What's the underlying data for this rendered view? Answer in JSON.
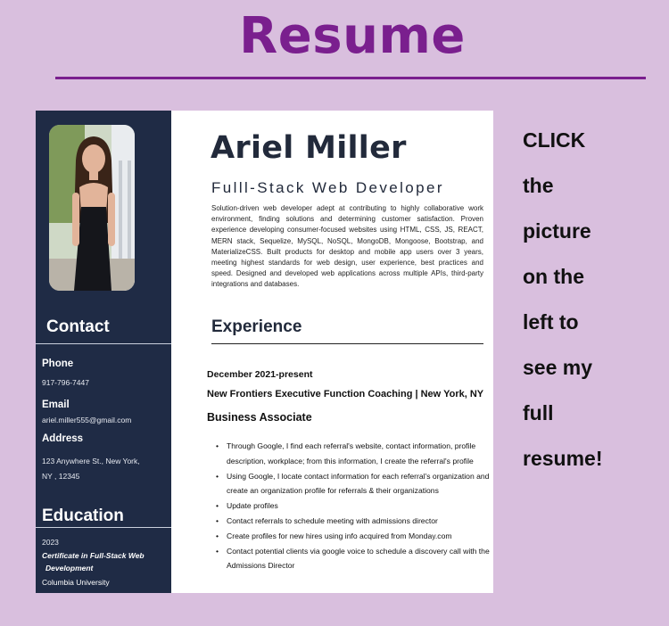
{
  "header": {
    "title": "Resume"
  },
  "resume": {
    "name": "Ariel Miller",
    "role": "Fulll-Stack Web Developer",
    "summary": "Solution-driven web developer adept at contributing to highly collaborative work environment, finding solutions and determining customer satisfaction. Proven experience developing consumer-focused websites using HTML, CSS, JS, REACT, MERN stack, Sequelize, MySQL, NoSQL, MongoDB, Mongoose, Bootstrap, and MaterializeCSS. Built products for desktop and mobile app users over 3 years, meeting highest standards for web design, user experience, best practices and speed. Designed and developed web applications across multiple APIs, third-party integrations and databases.",
    "sidebar": {
      "contact_heading": "Contact",
      "phone_label": "Phone",
      "phone": "917-796-7447",
      "email_label": "Email",
      "email": "ariel.miller555@gmail.com",
      "address_label": "Address",
      "address_line1": "123 Anywhere St.,  New York,",
      "address_line2": "NY , 12345",
      "education_heading": "Education",
      "edu_year": "2023",
      "edu_cert_line1": "Certificate in Full-Stack Web",
      "edu_cert_line2": "Development",
      "edu_school": "Columbia University"
    },
    "experience": {
      "heading": "Experience",
      "date": "December 2021-present",
      "org": "New Frontiers Executive Function Coaching | New York, NY",
      "role": "Business Associate",
      "bullets": [
        "Through Google, I find each referral's website, contact information, profile description, workplace; from this information, I create the referral's profile",
        "Using Google, I locate contact information for each referral's organization and create an organization profile for referrals & their organizations",
        "Update profiles",
        "Contact referrals to schedule meeting with admissions director",
        "Create profiles for new hires using info acquired from Monday.com",
        "Contact potential clients via google voice to schedule a discovery call with the Admissions Director"
      ]
    }
  },
  "instruction": {
    "words": [
      "CLICK",
      "the",
      "picture",
      "on the",
      "left to",
      "see my",
      "full",
      "resume!"
    ]
  }
}
